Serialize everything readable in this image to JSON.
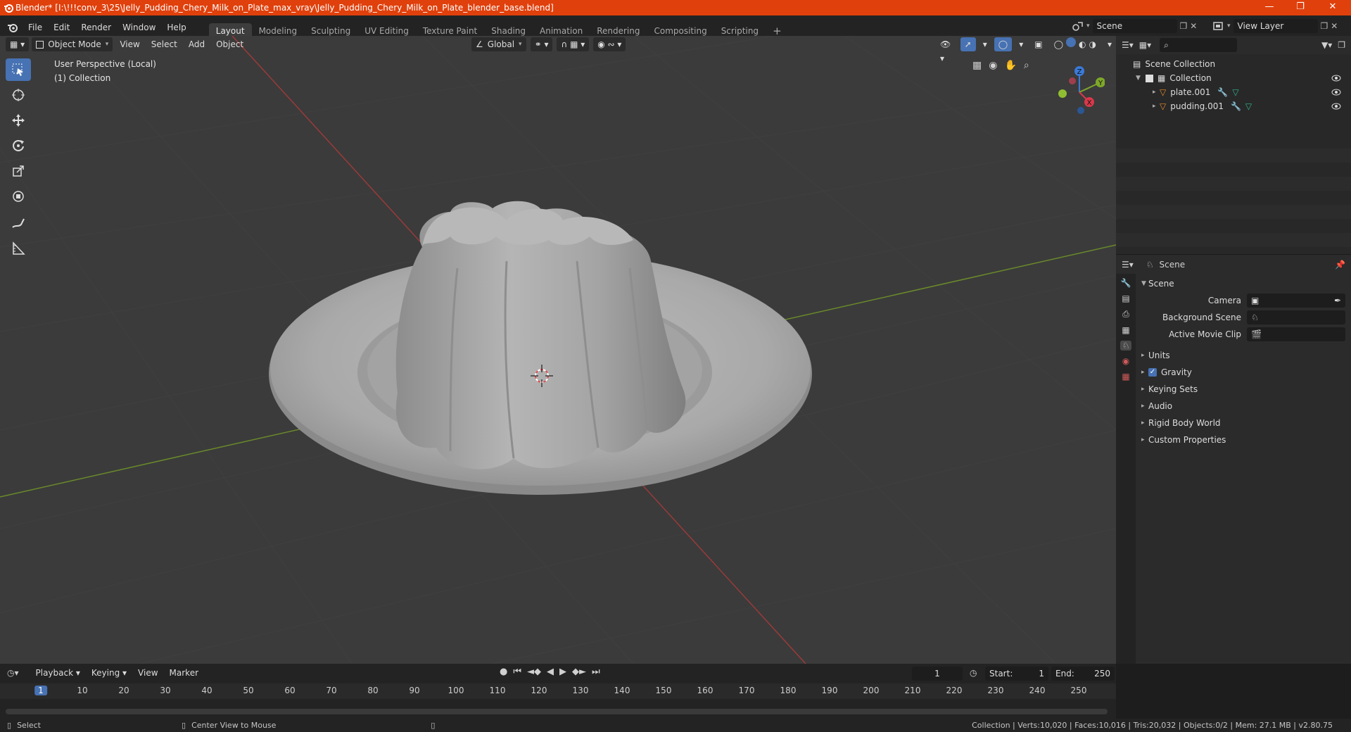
{
  "window": {
    "title": "Blender* [I:\\!!!conv_3\\25\\Jelly_Pudding_Chery_Milk_on_Plate_max_vray\\Jelly_Pudding_Chery_Milk_on_Plate_blender_base.blend]"
  },
  "menu": {
    "items": [
      "File",
      "Edit",
      "Render",
      "Window",
      "Help"
    ]
  },
  "workspaces": [
    "Layout",
    "Modeling",
    "Sculpting",
    "UV Editing",
    "Texture Paint",
    "Shading",
    "Animation",
    "Rendering",
    "Compositing",
    "Scripting"
  ],
  "scene_selector": {
    "value": "Scene"
  },
  "view_layer": {
    "value": "View Layer"
  },
  "viewport_header": {
    "mode": "Object Mode",
    "menus": [
      "View",
      "Select",
      "Add",
      "Object"
    ],
    "orientation": "Global"
  },
  "viewport": {
    "perspective": "User Perspective (Local)",
    "collection": "(1) Collection"
  },
  "gizmo": {
    "z": "Z",
    "y": "Y",
    "x": "X"
  },
  "outliner": {
    "root": "Scene Collection",
    "collection": "Collection",
    "objects": [
      "plate.001",
      "pudding.001"
    ]
  },
  "properties": {
    "header": "Scene",
    "panel_title": "Scene",
    "camera_label": "Camera",
    "background_scene_label": "Background Scene",
    "active_clip_label": "Active Movie Clip",
    "sections": [
      "Units",
      "Gravity",
      "Keying Sets",
      "Audio",
      "Rigid Body World",
      "Custom Properties"
    ],
    "gravity_checked": true
  },
  "timeline": {
    "menus": [
      "Playback",
      "Keying",
      "View",
      "Marker"
    ],
    "current_frame": "1",
    "start_label": "Start:",
    "start": "1",
    "end_label": "End:",
    "end": "250",
    "ticks": [
      "1",
      "10",
      "20",
      "30",
      "40",
      "50",
      "60",
      "70",
      "80",
      "90",
      "100",
      "110",
      "120",
      "130",
      "140",
      "150",
      "160",
      "170",
      "180",
      "190",
      "200",
      "210",
      "220",
      "230",
      "240",
      "250"
    ]
  },
  "statusbar": {
    "select": "Select",
    "center": "Center View to Mouse",
    "stats": "Collection | Verts:10,020 | Faces:10,016 | Tris:20,032 | Objects:0/2 | Mem: 27.1 MB | v2.80.75"
  },
  "colors": {
    "titlebar": "#e0400c",
    "accent": "#4772b3",
    "viewport": "#3b3b3b"
  }
}
